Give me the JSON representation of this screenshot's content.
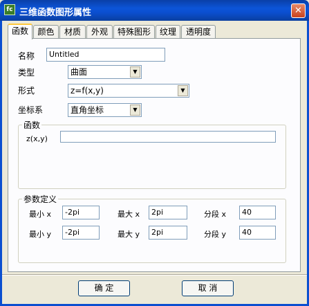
{
  "window": {
    "title": "三维函数图形属性",
    "icon_text": "fc",
    "close_glyph": "✕"
  },
  "tabs": [
    {
      "label": "函数",
      "active": true
    },
    {
      "label": "颜色"
    },
    {
      "label": "材质"
    },
    {
      "label": "外观"
    },
    {
      "label": "特殊图形"
    },
    {
      "label": "纹理"
    },
    {
      "label": "透明度"
    }
  ],
  "form": {
    "name_label": "名称",
    "name_value": "Untitled",
    "type_label": "类型",
    "type_value": "曲面",
    "form_label": "形式",
    "form_value": "z=f(x,y)",
    "coord_label": "坐标系",
    "coord_value": "直角坐标"
  },
  "function_group": {
    "title": "函数",
    "expr_label": "z(x,y)",
    "expr_value": ""
  },
  "param_group": {
    "title": "参数定义",
    "min_x_label": "最小 x",
    "min_x_value": "-2pi",
    "max_x_label": "最大 x",
    "max_x_value": "2pi",
    "seg_x_label": "分段 x",
    "seg_x_value": "40",
    "min_y_label": "最小 y",
    "min_y_value": "-2pi",
    "max_y_label": "最大 y",
    "max_y_value": "2pi",
    "seg_y_label": "分段 y",
    "seg_y_value": "40"
  },
  "buttons": {
    "ok": "确 定",
    "cancel": "取 消"
  }
}
